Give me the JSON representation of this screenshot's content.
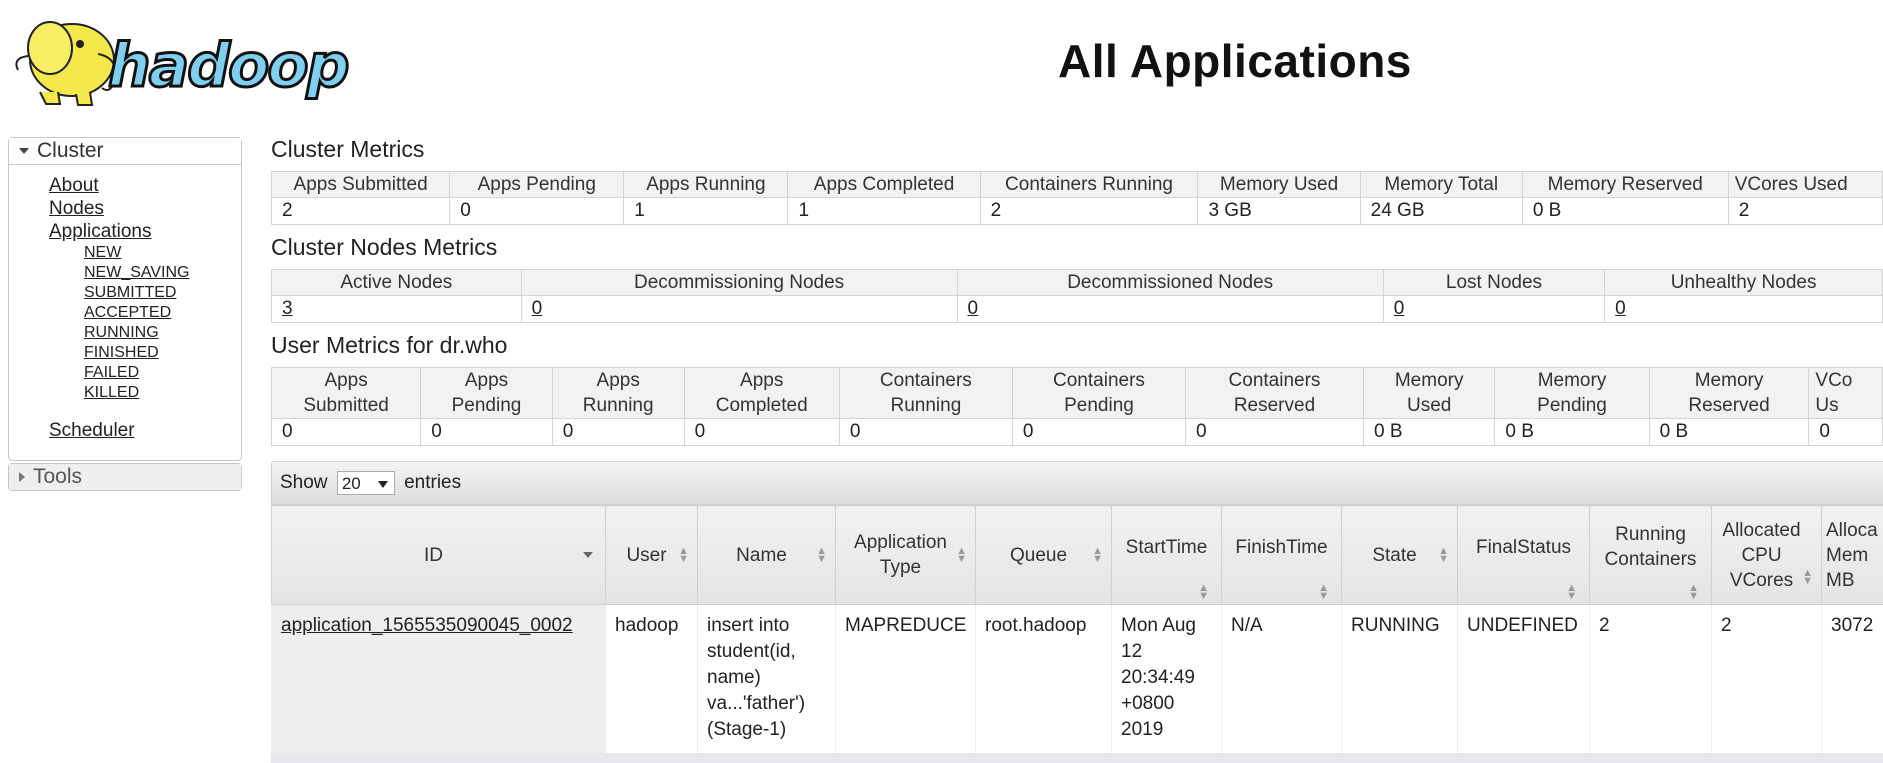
{
  "header": {
    "title": "All Applications",
    "logo_text": "hadoop"
  },
  "sidebar": {
    "cluster_label": "Cluster",
    "links": [
      "About",
      "Nodes",
      "Applications"
    ],
    "app_states": [
      "NEW",
      "NEW_SAVING",
      "SUBMITTED",
      "ACCEPTED",
      "RUNNING",
      "FINISHED",
      "FAILED",
      "KILLED"
    ],
    "scheduler_label": "Scheduler",
    "tools_label": "Tools"
  },
  "cluster_metrics": {
    "title": "Cluster Metrics",
    "headers": [
      "Apps Submitted",
      "Apps Pending",
      "Apps Running",
      "Apps Completed",
      "Containers Running",
      "Memory Used",
      "Memory Total",
      "Memory Reserved",
      "VCores Used"
    ],
    "values": [
      "2",
      "0",
      "1",
      "1",
      "2",
      "3 GB",
      "24 GB",
      "0 B",
      "2"
    ]
  },
  "nodes_metrics": {
    "title": "Cluster Nodes Metrics",
    "headers": [
      "Active Nodes",
      "Decommissioning Nodes",
      "Decommissioned Nodes",
      "Lost Nodes",
      "Unhealthy Nodes"
    ],
    "values": [
      "3",
      "0",
      "0",
      "0",
      "0"
    ]
  },
  "user_metrics": {
    "title": "User Metrics for dr.who",
    "headers": [
      [
        "Apps",
        "Submitted"
      ],
      [
        "Apps",
        "Pending"
      ],
      [
        "Apps",
        "Running"
      ],
      [
        "Apps",
        "Completed"
      ],
      [
        "Containers",
        "Running"
      ],
      [
        "Containers",
        "Pending"
      ],
      [
        "Containers",
        "Reserved"
      ],
      [
        "Memory",
        "Used"
      ],
      [
        "Memory",
        "Pending"
      ],
      [
        "Memory",
        "Reserved"
      ],
      [
        "VCo",
        "Us"
      ]
    ],
    "values": [
      "0",
      "0",
      "0",
      "0",
      "0",
      "0",
      "0",
      "0 B",
      "0 B",
      "0 B",
      "0"
    ]
  },
  "apps_table": {
    "show_label": "Show",
    "page_length": "20",
    "entries_label": "entries",
    "headers": [
      [
        "ID"
      ],
      [
        "User"
      ],
      [
        "Name"
      ],
      [
        "Application",
        "Type"
      ],
      [
        "Queue"
      ],
      [
        "StartTime"
      ],
      [
        "FinishTime"
      ],
      [
        "State"
      ],
      [
        "FinalStatus"
      ],
      [
        "Running",
        "Containers"
      ],
      [
        "Allocated",
        "CPU",
        "VCores"
      ],
      [
        "Alloca",
        "Mem",
        "MB"
      ]
    ],
    "rows": [
      {
        "id": "application_1565535090045_0002",
        "user": "hadoop",
        "name": [
          "insert into",
          "student(id,",
          "name)",
          "va...'father')",
          "(Stage-1)"
        ],
        "type": "MAPREDUCE",
        "queue": "root.hadoop",
        "start": [
          "Mon Aug",
          "12",
          "20:34:49",
          "+0800",
          "2019"
        ],
        "finish": "N/A",
        "state": "RUNNING",
        "final_status": "UNDEFINED",
        "running_containers": "2",
        "vcores": "2",
        "memory": "3072"
      }
    ]
  }
}
